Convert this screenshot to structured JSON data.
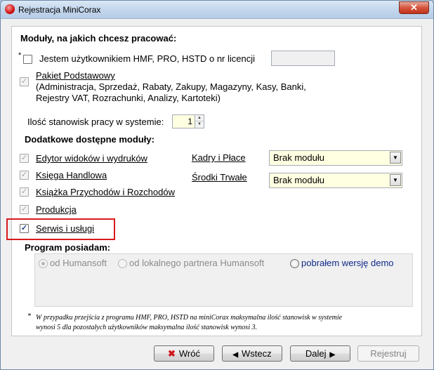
{
  "window": {
    "title": "Rejestracja MiniCorax",
    "close_glyph": "✕"
  },
  "modules_heading": "Moduły, na jakich chcesz pracować:",
  "user_option": {
    "asterisk": "*",
    "label": "Jestem użytkownikiem  HMF, PRO, HSTD o nr licencji",
    "license_value": ""
  },
  "base_package": {
    "name": "Pakiet Podstawowy",
    "desc_line1": "(Administracja, Sprzedaż, Rabaty, Zakupy, Magazyny, Kasy, Banki,",
    "desc_line2": "Rejestry VAT, Rozrachunki, Analizy, Kartoteki)"
  },
  "workstations": {
    "label": "Ilość stanowisk pracy w systemie:",
    "value": "1"
  },
  "additional_heading": "Dodatkowe dostępne moduły:",
  "modules": [
    {
      "label": "Edytor widoków i wydruków"
    },
    {
      "label": "Księga Handlowa"
    },
    {
      "label": "Książka Przychodów i Rozchodów"
    },
    {
      "label": "Produkcja"
    },
    {
      "label": "Serwis i usługi"
    }
  ],
  "hr_module": {
    "label": "Kadry i Płace",
    "value": "Brak modułu"
  },
  "assets_module": {
    "label": "Środki Trwałe",
    "value": "Brak modułu"
  },
  "program_heading": "Program posiadam:",
  "program_options": [
    {
      "label": "od Humansoft"
    },
    {
      "label": "od lokalnego partnera Humansoft"
    },
    {
      "label": "pobrałem wersję demo"
    }
  ],
  "footnote": {
    "asterisk": "*",
    "line1": "W przypadku przejścia z programu HMF, PRO, HSTD na miniCorax maksymalna ilość stanowisk w systemie",
    "line2": "wynosi 5 dla pozostałych użytkowników maksymalna ilość stanowisk wynosi  3."
  },
  "buttons": {
    "back_all": "Wróć",
    "back": "Wstecz",
    "next": "Dalej",
    "register": "Rejestruj"
  },
  "icons": {
    "check": "✓",
    "spin_up": "▲",
    "spin_down": "▼",
    "dropdown": "▼",
    "cross": "✖",
    "left": "◀",
    "right": "▶"
  },
  "colors": {
    "highlight": "#d9191d",
    "field_bg": "#ffffe1",
    "demo_text": "#0f2a8a"
  }
}
